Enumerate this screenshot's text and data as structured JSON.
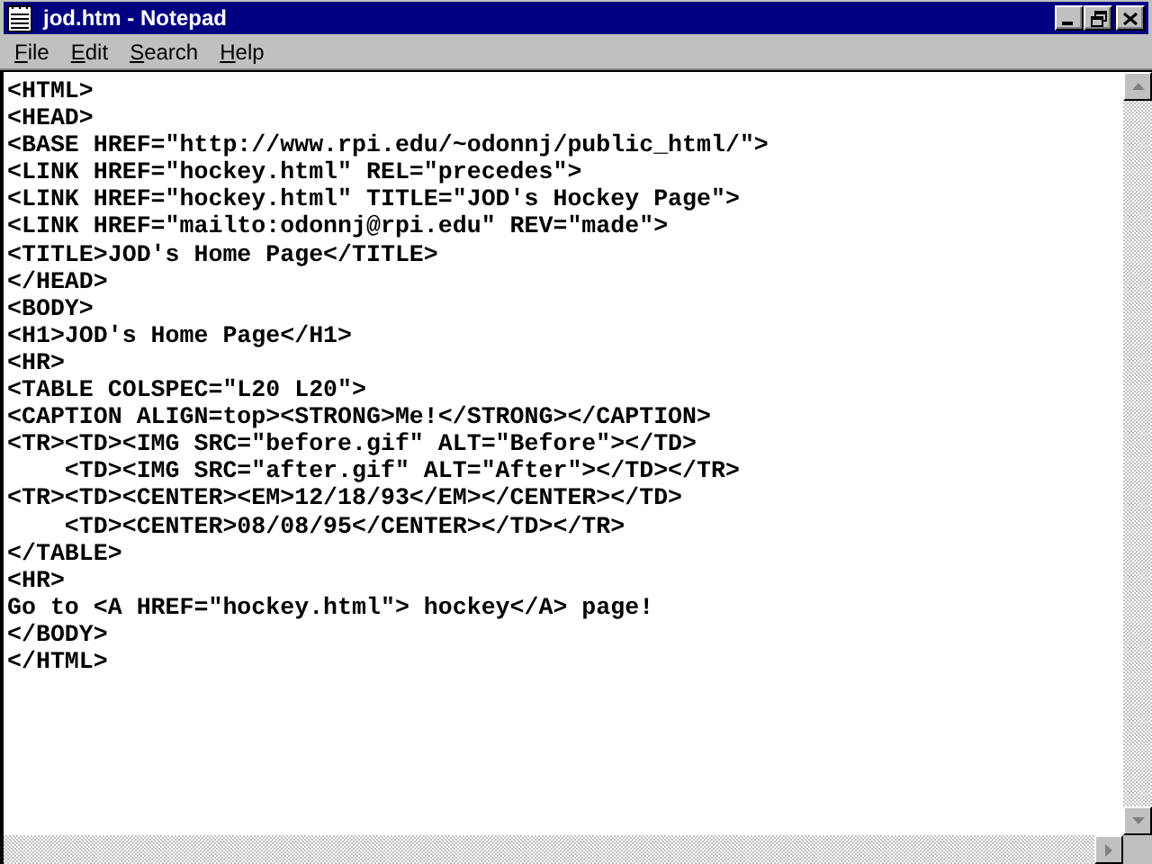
{
  "window": {
    "title": "jod.htm - Notepad"
  },
  "menu": [
    {
      "label": "File"
    },
    {
      "label": "Edit"
    },
    {
      "label": "Search"
    },
    {
      "label": "Help"
    }
  ],
  "editor": {
    "lines": [
      "<HTML>",
      "<HEAD>",
      "<BASE HREF=\"http://www.rpi.edu/~odonnj/public_html/\">",
      "<LINK HREF=\"hockey.html\" REL=\"precedes\">",
      "<LINK HREF=\"hockey.html\" TITLE=\"JOD's Hockey Page\">",
      "<LINK HREF=\"mailto:odonnj@rpi.edu\" REV=\"made\">",
      "<TITLE>JOD's Home Page</TITLE>",
      "</HEAD>",
      "<BODY>",
      "<H1>JOD's Home Page</H1>",
      "<HR>",
      "<TABLE COLSPEC=\"L20 L20\">",
      "<CAPTION ALIGN=top><STRONG>Me!</STRONG></CAPTION>",
      "<TR><TD><IMG SRC=\"before.gif\" ALT=\"Before\"></TD>",
      "    <TD><IMG SRC=\"after.gif\" ALT=\"After\"></TD></TR>",
      "<TR><TD><CENTER><EM>12/18/93</EM></CENTER></TD>",
      "    <TD><CENTER>08/08/95</CENTER></TD></TR>",
      "</TABLE>",
      "<HR>",
      "Go to <A HREF=\"hockey.html\"> hockey</A> page!",
      "</BODY>",
      "</HTML>"
    ]
  }
}
